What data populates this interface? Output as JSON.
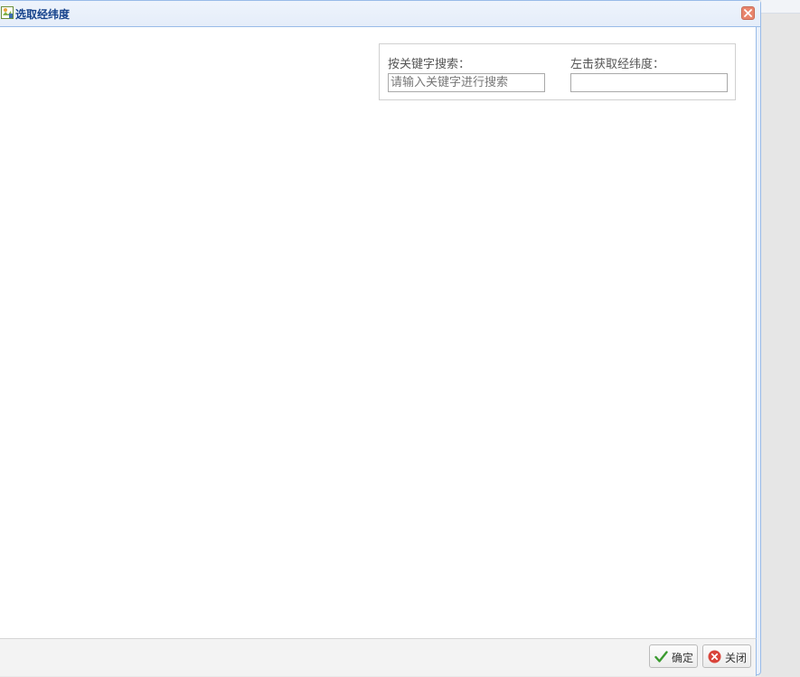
{
  "dialog": {
    "title": "选取经纬度",
    "title_icon": "map-pin-icon",
    "close_icon": "close-icon"
  },
  "search": {
    "keyword_label": "按关键字搜索：",
    "keyword_placeholder": "请输入关键字进行搜索",
    "keyword_value": "",
    "latlng_label": "左击获取经纬度：",
    "latlng_value": ""
  },
  "footer": {
    "ok_label": "确定",
    "ok_icon": "check-icon",
    "close_label": "关闭",
    "close_icon": "cancel-icon"
  },
  "colors": {
    "title_text": "#15428b",
    "border": "#99bbe8",
    "close_button": "#e8856c",
    "ok_check": "#3a9a2f",
    "cancel_red": "#d9443a"
  }
}
